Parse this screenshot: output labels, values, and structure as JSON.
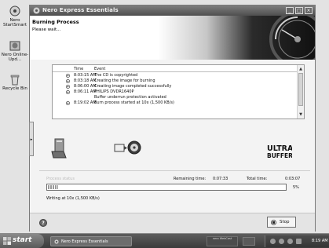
{
  "desktop": {
    "icons": [
      {
        "label": "Nero StartSmart"
      },
      {
        "label": "Nero Online-Upd..."
      },
      {
        "label": "Recycle Bin"
      }
    ]
  },
  "window": {
    "title": "Nero Express Essentials",
    "header_title": "Burning Process",
    "header_subtitle": "Please wait...",
    "log_columns": [
      "Time",
      "Event"
    ],
    "log": [
      {
        "icon": "info-icon",
        "time": "8:03:15 AM",
        "event": "The CD is copyrighted"
      },
      {
        "icon": "info-icon",
        "time": "8:03:18 AM",
        "event": "Creating the image for burning"
      },
      {
        "icon": "info-icon",
        "time": "8:06:00 AM",
        "event": "Creating image completed successfully"
      },
      {
        "icon": "info-icon",
        "time": "8:06:11 AM",
        "event": "PHILIPS DVDR1640P"
      },
      {
        "icon": "",
        "time": "",
        "event": "Buffer underrun protection activated"
      },
      {
        "icon": "info-icon",
        "time": "8:19:02 AM",
        "event": "Burn process started at 10x (1,500 KB/s)"
      }
    ],
    "status": {
      "process_label": "Process status",
      "remaining_label": "Remaining time:",
      "remaining_value": "0:07:33",
      "total_label": "Total time:",
      "total_value": "0:03:07",
      "progress_percent": 5,
      "progress_text": "5%",
      "writing_text": "Writing at 10x (1,500 KB/s)"
    },
    "stop_label": "Stop",
    "brand_logo_text": "ULTRA BUFFER"
  },
  "taskbar": {
    "start_label": "start",
    "task_label": "Nero Express Essentials",
    "tray_logo_text": "nero WebCast",
    "clock": "8:19 AM"
  },
  "colors": {
    "titlebar": "#5f5f5f",
    "taskbar": "#4a4a4a",
    "window_bg": "#f3f3f3"
  }
}
